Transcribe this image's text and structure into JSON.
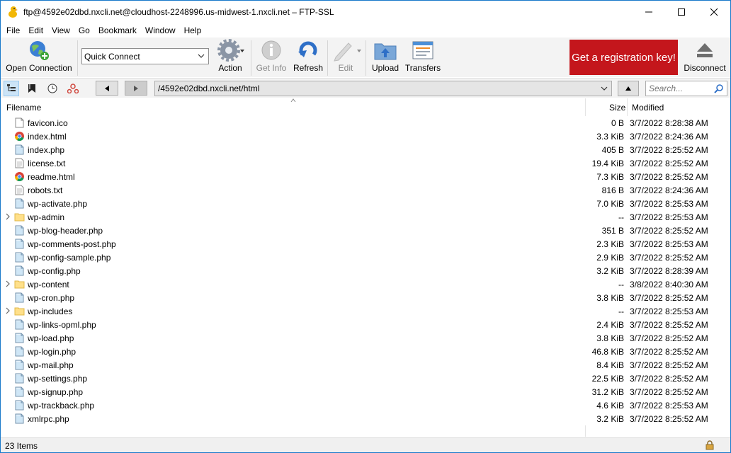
{
  "window": {
    "title": "ftp@4592e02dbd.nxcli.net@cloudhost-2248996.us-midwest-1.nxcli.net – FTP-SSL"
  },
  "menu": [
    "File",
    "Edit",
    "View",
    "Go",
    "Bookmark",
    "Window",
    "Help"
  ],
  "toolbar": {
    "open_connection": "Open Connection",
    "quick_connect": "Quick Connect",
    "action": "Action",
    "get_info": "Get Info",
    "refresh": "Refresh",
    "edit": "Edit",
    "upload": "Upload",
    "transfers": "Transfers",
    "registration": "Get a registration key!",
    "disconnect": "Disconnect"
  },
  "navigation": {
    "path": "/4592e02dbd.nxcli.net/html",
    "search_placeholder": "Search..."
  },
  "columns": {
    "filename": "Filename",
    "size": "Size",
    "modified": "Modified"
  },
  "files": [
    {
      "name": "favicon.ico",
      "size": "0 B",
      "modified": "3/7/2022 8:28:38 AM",
      "type": "blank"
    },
    {
      "name": "index.html",
      "size": "3.3 KiB",
      "modified": "3/7/2022 8:24:36 AM",
      "type": "html"
    },
    {
      "name": "index.php",
      "size": "405 B",
      "modified": "3/7/2022 8:25:52 AM",
      "type": "php"
    },
    {
      "name": "license.txt",
      "size": "19.4 KiB",
      "modified": "3/7/2022 8:25:52 AM",
      "type": "txt"
    },
    {
      "name": "readme.html",
      "size": "7.3 KiB",
      "modified": "3/7/2022 8:25:52 AM",
      "type": "html"
    },
    {
      "name": "robots.txt",
      "size": "816 B",
      "modified": "3/7/2022 8:24:36 AM",
      "type": "txt"
    },
    {
      "name": "wp-activate.php",
      "size": "7.0 KiB",
      "modified": "3/7/2022 8:25:53 AM",
      "type": "php"
    },
    {
      "name": "wp-admin",
      "size": "--",
      "modified": "3/7/2022 8:25:53 AM",
      "type": "folder"
    },
    {
      "name": "wp-blog-header.php",
      "size": "351 B",
      "modified": "3/7/2022 8:25:52 AM",
      "type": "php"
    },
    {
      "name": "wp-comments-post.php",
      "size": "2.3 KiB",
      "modified": "3/7/2022 8:25:53 AM",
      "type": "php"
    },
    {
      "name": "wp-config-sample.php",
      "size": "2.9 KiB",
      "modified": "3/7/2022 8:25:52 AM",
      "type": "php"
    },
    {
      "name": "wp-config.php",
      "size": "3.2 KiB",
      "modified": "3/7/2022 8:28:39 AM",
      "type": "php"
    },
    {
      "name": "wp-content",
      "size": "--",
      "modified": "3/8/2022 8:40:30 AM",
      "type": "folder"
    },
    {
      "name": "wp-cron.php",
      "size": "3.8 KiB",
      "modified": "3/7/2022 8:25:52 AM",
      "type": "php"
    },
    {
      "name": "wp-includes",
      "size": "--",
      "modified": "3/7/2022 8:25:53 AM",
      "type": "folder"
    },
    {
      "name": "wp-links-opml.php",
      "size": "2.4 KiB",
      "modified": "3/7/2022 8:25:52 AM",
      "type": "php"
    },
    {
      "name": "wp-load.php",
      "size": "3.8 KiB",
      "modified": "3/7/2022 8:25:52 AM",
      "type": "php"
    },
    {
      "name": "wp-login.php",
      "size": "46.8 KiB",
      "modified": "3/7/2022 8:25:52 AM",
      "type": "php"
    },
    {
      "name": "wp-mail.php",
      "size": "8.4 KiB",
      "modified": "3/7/2022 8:25:52 AM",
      "type": "php"
    },
    {
      "name": "wp-settings.php",
      "size": "22.5 KiB",
      "modified": "3/7/2022 8:25:52 AM",
      "type": "php"
    },
    {
      "name": "wp-signup.php",
      "size": "31.2 KiB",
      "modified": "3/7/2022 8:25:52 AM",
      "type": "php"
    },
    {
      "name": "wp-trackback.php",
      "size": "4.6 KiB",
      "modified": "3/7/2022 8:25:53 AM",
      "type": "php"
    },
    {
      "name": "xmlrpc.php",
      "size": "3.2 KiB",
      "modified": "3/7/2022 8:25:52 AM",
      "type": "php"
    }
  ],
  "status": {
    "items": "23 Items"
  },
  "colors": {
    "registration_bg": "#c4161c",
    "window_border": "#1979ca",
    "toolbar_bg": "#f3f3f3"
  }
}
